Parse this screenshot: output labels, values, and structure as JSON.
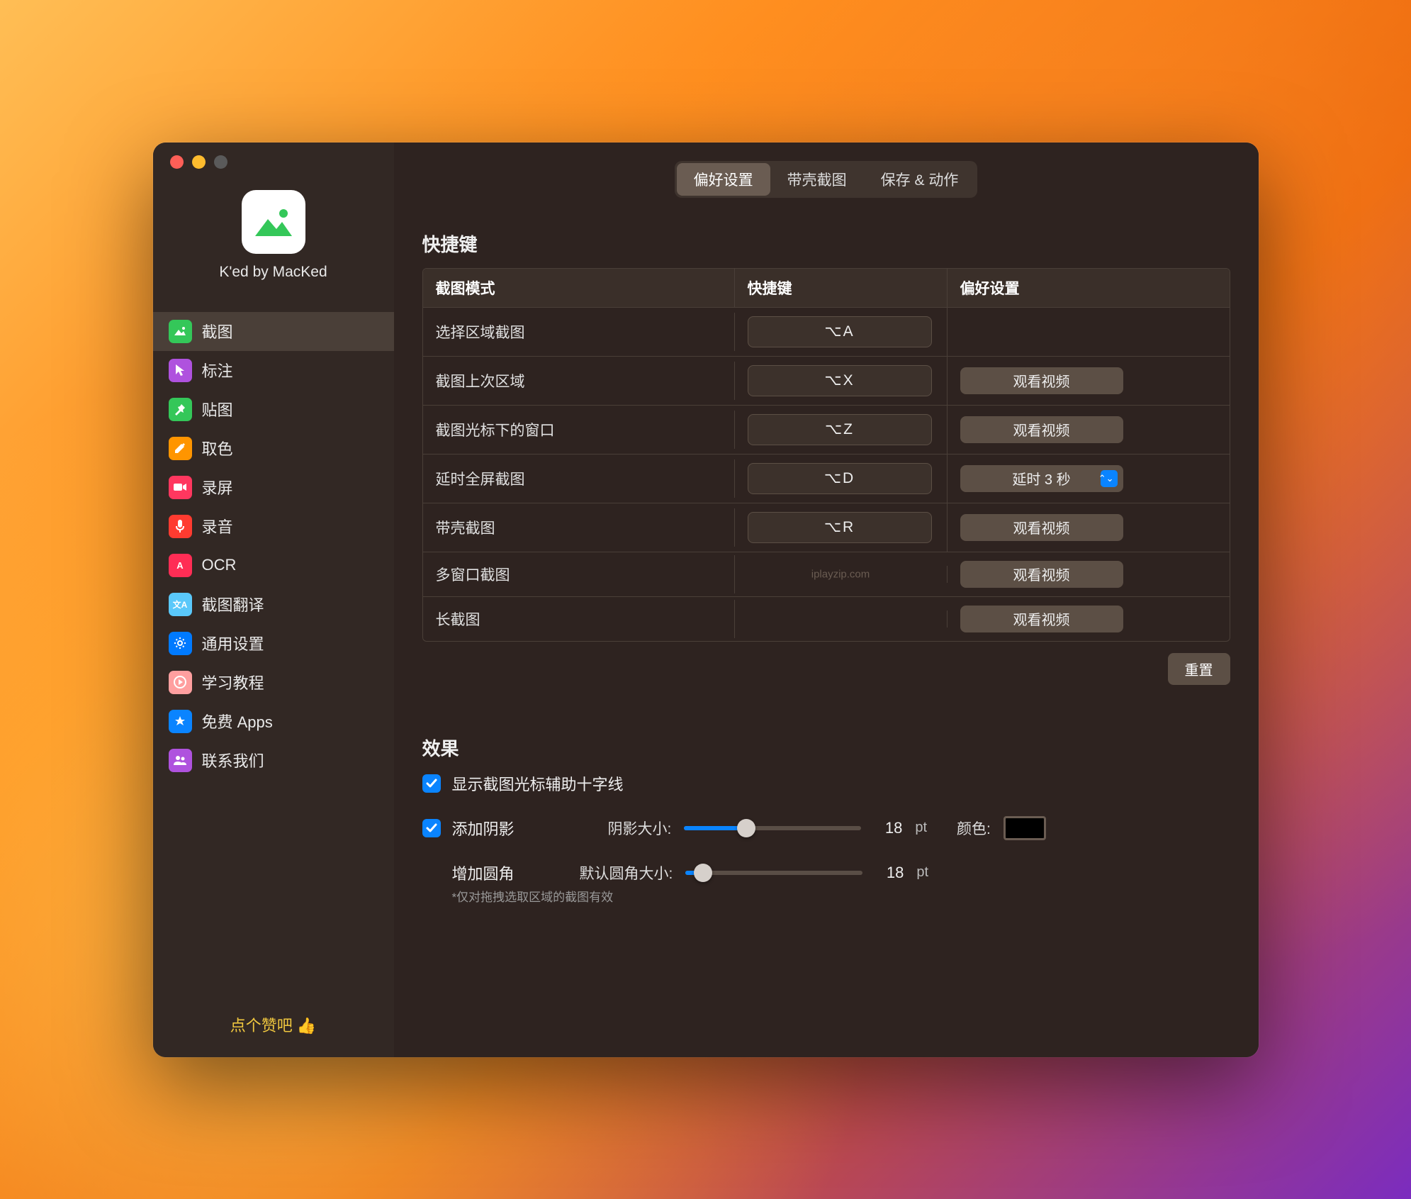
{
  "sidebar": {
    "app_title": "K'ed by MacKed",
    "items": [
      {
        "label": "截图",
        "icon": "image-icon",
        "color": "#34c759"
      },
      {
        "label": "标注",
        "icon": "cursor-icon",
        "color": "#af52de"
      },
      {
        "label": "贴图",
        "icon": "pin-icon",
        "color": "#34c759"
      },
      {
        "label": "取色",
        "icon": "eyedropper-icon",
        "color": "#ff9500"
      },
      {
        "label": "录屏",
        "icon": "video-icon",
        "color": "#ff375f"
      },
      {
        "label": "录音",
        "icon": "mic-icon",
        "color": "#ff3b30"
      },
      {
        "label": "OCR",
        "icon": "ocr-icon",
        "color": "#ff2d55"
      },
      {
        "label": "截图翻译",
        "icon": "translate-icon",
        "color": "#5ac8fa"
      },
      {
        "label": "通用设置",
        "icon": "gear-icon",
        "color": "#007aff"
      },
      {
        "label": "学习教程",
        "icon": "tutorial-icon",
        "color": "#ff9f9f"
      },
      {
        "label": "免费 Apps",
        "icon": "apps-icon",
        "color": "#0a84ff"
      },
      {
        "label": "联系我们",
        "icon": "contact-icon",
        "color": "#af52de"
      }
    ],
    "footer": "点个赞吧 👍"
  },
  "tabs": {
    "preferences": "偏好设置",
    "shell": "带壳截图",
    "save": "保存 & 动作"
  },
  "shortcuts": {
    "section_title": "快捷键",
    "headers": {
      "mode": "截图模式",
      "shortcut": "快捷键",
      "pref": "偏好设置"
    },
    "rows": [
      {
        "mode": "选择区域截图",
        "shortcut": "⌥A",
        "pref_type": "none"
      },
      {
        "mode": "截图上次区域",
        "shortcut": "⌥X",
        "pref_type": "button",
        "pref_label": "观看视频"
      },
      {
        "mode": "截图光标下的窗口",
        "shortcut": "⌥Z",
        "pref_type": "button",
        "pref_label": "观看视频"
      },
      {
        "mode": "延时全屏截图",
        "shortcut": "⌥D",
        "pref_type": "select",
        "pref_label": "延时 3 秒"
      },
      {
        "mode": "带壳截图",
        "shortcut": "⌥R",
        "pref_type": "button",
        "pref_label": "观看视频"
      },
      {
        "mode": "多窗口截图",
        "shortcut": "",
        "pref_type": "button",
        "pref_label": "观看视频"
      },
      {
        "mode": "长截图",
        "shortcut": "",
        "pref_type": "button",
        "pref_label": "观看视频"
      }
    ],
    "reset": "重置"
  },
  "effects": {
    "section_title": "效果",
    "crosshair_label": "显示截图光标辅助十字线",
    "shadow_label": "添加阴影",
    "shadow_size_label": "阴影大小:",
    "shadow_value": "18",
    "shadow_unit": "pt",
    "color_label": "颜色:",
    "corner_label": "增加圆角",
    "corner_size_label": "默认圆角大小:",
    "corner_value": "18",
    "corner_unit": "pt",
    "corner_hint": "*仅对拖拽选取区域的截图有效"
  },
  "watermark": "iplayzip.com"
}
